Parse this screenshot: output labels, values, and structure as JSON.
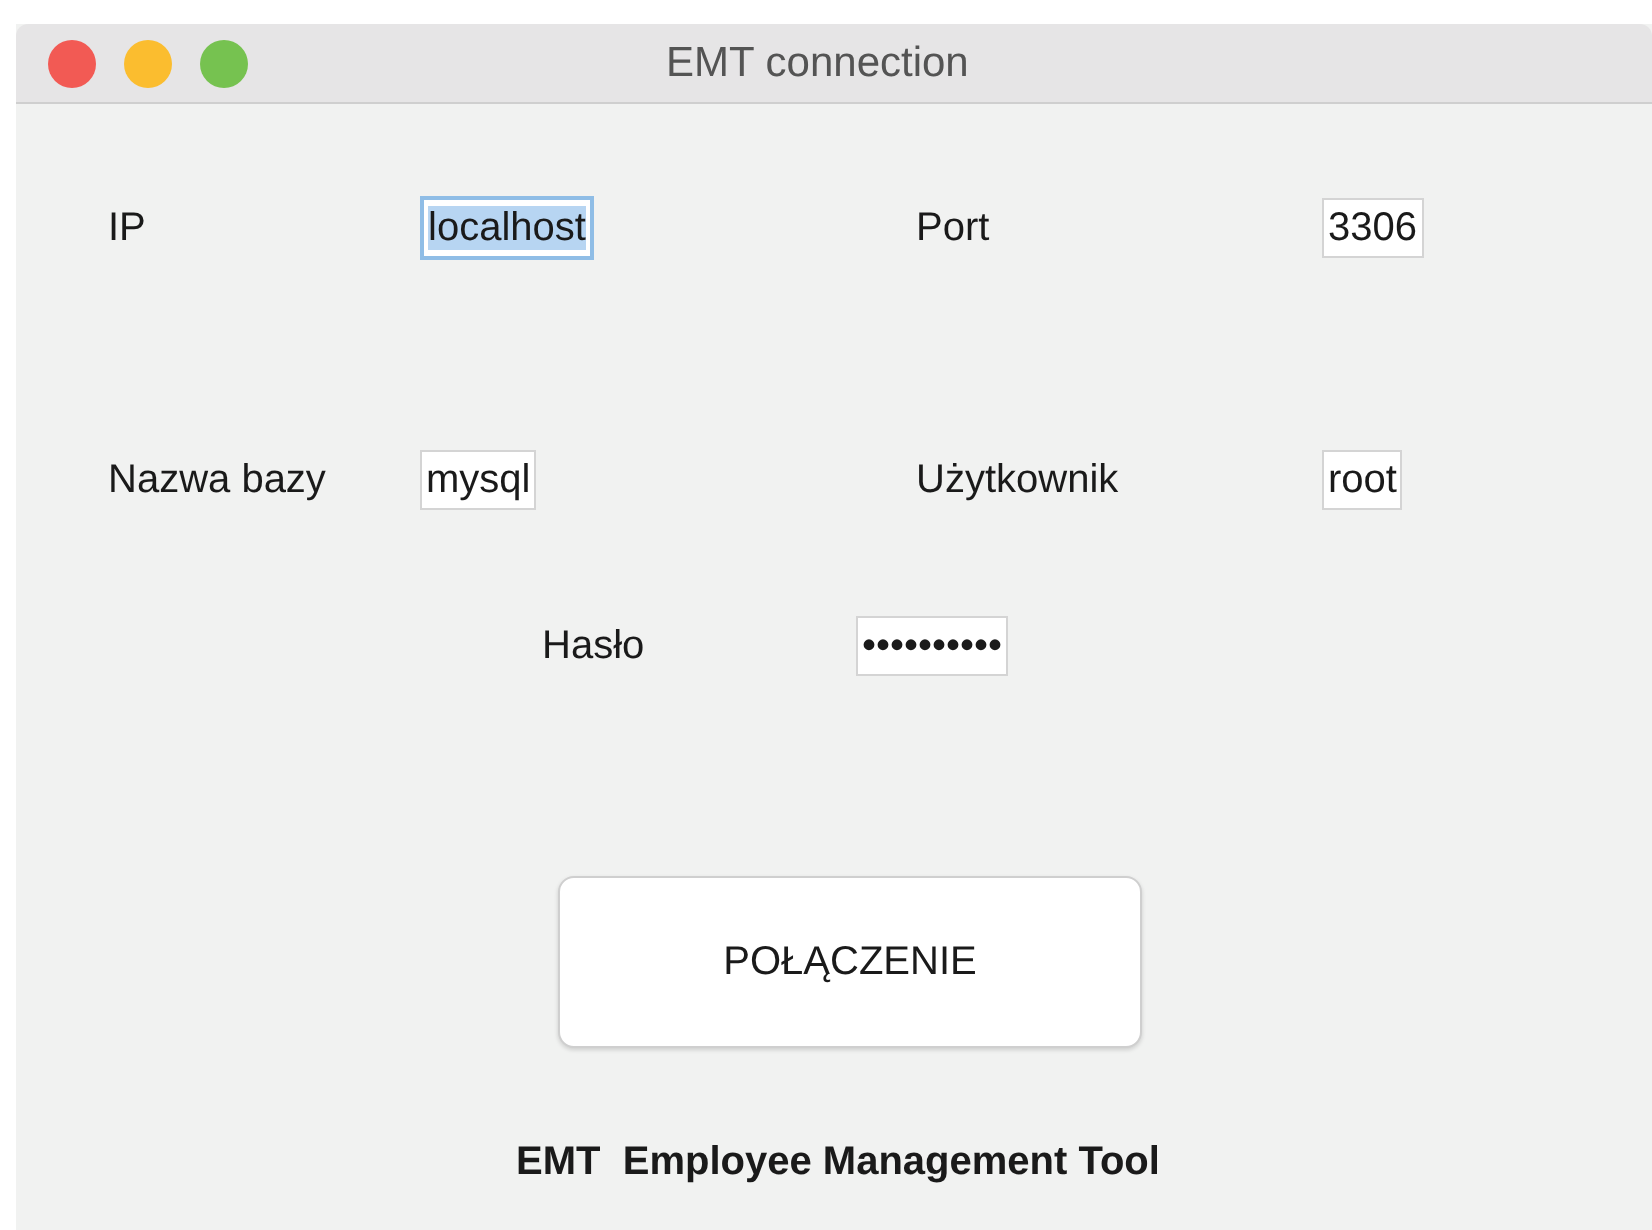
{
  "window": {
    "title": "EMT connection"
  },
  "rows": [
    {
      "fields": [
        {
          "label": "IP",
          "value": "localhost",
          "focused": true
        },
        {
          "label": "Port",
          "value": "3306",
          "focused": false
        }
      ]
    },
    {
      "fields": [
        {
          "label": "Nazwa bazy",
          "value": "mysql",
          "focused": false
        },
        {
          "label": "Użytkownik",
          "value": "root",
          "focused": false
        }
      ]
    }
  ],
  "password": {
    "label": "Hasło",
    "value": "••••••••••",
    "focused": false
  },
  "connect_button": {
    "label": "POŁĄCZENIE"
  },
  "footer": "EMT  Employee Management Tool"
}
